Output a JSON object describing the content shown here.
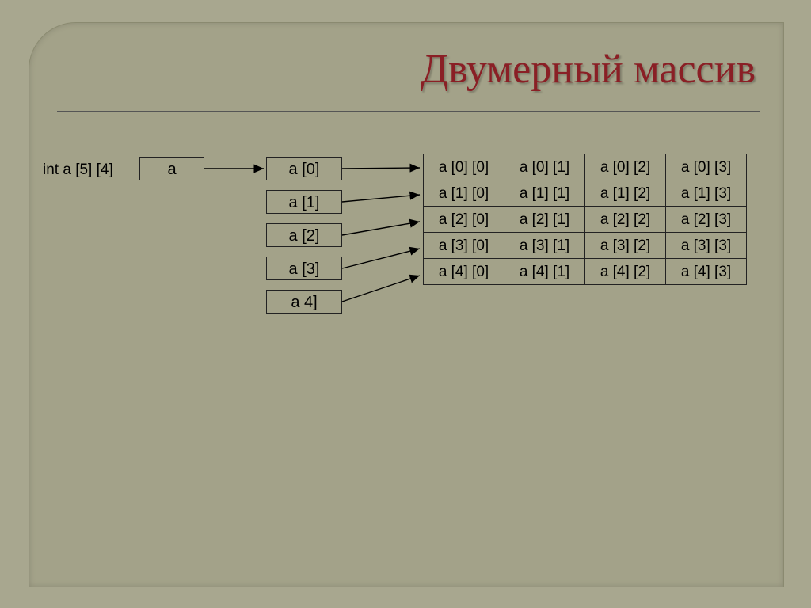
{
  "title": "Двумерный массив",
  "declaration": "int a [5] [4]",
  "pointer_label": "a",
  "mid_column": [
    "a [0]",
    "a [1]",
    "a [2]",
    "a [3]",
    "a 4]"
  ],
  "grid": [
    [
      "a [0] [0]",
      "a [0] [1]",
      "a [0] [2]",
      "a [0] [3]"
    ],
    [
      "a [1] [0]",
      "a [1] [1]",
      "a [1] [2]",
      "a [1] [3]"
    ],
    [
      "a [2] [0]",
      "a [2] [1]",
      "a [2] [2]",
      "a [2] [3]"
    ],
    [
      "a [3] [0]",
      "a [3] [1]",
      "a [3] [2]",
      "a [3] [3]"
    ],
    [
      "a [4] [0]",
      "a [4] [1]",
      "a [4] [2]",
      "a [4] [3]"
    ]
  ],
  "chart_data": {
    "type": "table",
    "title": "Двумерный массив",
    "declaration": "int a[5][4]",
    "pointer_chain": {
      "root": "a",
      "first_level": [
        "a[0]",
        "a[1]",
        "a[2]",
        "a[3]",
        "a[4]"
      ],
      "elements": [
        [
          "a[0][0]",
          "a[0][1]",
          "a[0][2]",
          "a[0][3]"
        ],
        [
          "a[1][0]",
          "a[1][1]",
          "a[1][2]",
          "a[1][3]"
        ],
        [
          "a[2][0]",
          "a[2][1]",
          "a[2][2]",
          "a[2][3]"
        ],
        [
          "a[3][0]",
          "a[3][1]",
          "a[3][2]",
          "a[3][3]"
        ],
        [
          "a[4][0]",
          "a[4][1]",
          "a[4][2]",
          "a[4][3]"
        ]
      ]
    }
  }
}
